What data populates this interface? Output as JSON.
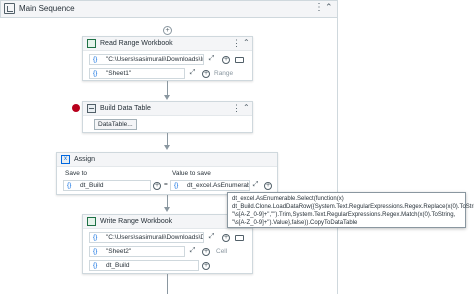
{
  "sequence": {
    "title": "Main Sequence"
  },
  "read_range": {
    "title": "Read Range Workbook",
    "path_value": "\"C:\\Users\\sasimurali\\Downloads\\Input",
    "sheet_value": "\"Sheet1\"",
    "range_hint": "Range"
  },
  "build_table": {
    "title": "Build Data Table",
    "button_label": "DataTable..."
  },
  "assign": {
    "title": "Assign",
    "save_to_label": "Save to",
    "value_label": "Value to save",
    "save_to_value": "dt_Build",
    "equals": "=",
    "value_text": "dt_excel.AsEnumerable"
  },
  "tooltip": {
    "text": "dt_excel.AsEnumerable.Select(function(x) dt_Build.Clone.LoadDataRow({System.Text.RegularExpressions.Regex.Replace(x(0).ToString, \"\\s[A-Z_0-9]+\",\"\").Trim,System.Text.RegularExpressions.Regex.Match(x(0).ToString, \"\\s[A-Z_0-9]+\").Value},false)).CopyToDataTable"
  },
  "write_range": {
    "title": "Write Range Workbook",
    "path_value": "\"C:\\Users\\sasimurali\\Downloads\\DELE",
    "sheet_value": "\"Sheet2\"",
    "cell_hint": "Cell",
    "datatable_value": "dt_Build"
  },
  "glyphs": {
    "brace": "{}",
    "plus": "+",
    "dots": "⋮",
    "collapse": "⌃",
    "expand_arrows": "⤢"
  },
  "colors": {
    "accent": "#0067df",
    "breakpoint": "#b8001c",
    "border": "#cfd8dd"
  }
}
